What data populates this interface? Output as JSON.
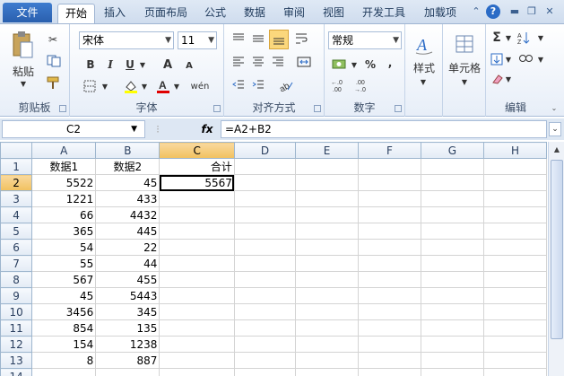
{
  "tabs": {
    "file": "文件",
    "items": [
      "开始",
      "插入",
      "页面布局",
      "公式",
      "数据",
      "审阅",
      "视图",
      "开发工具",
      "加载项"
    ],
    "active": "开始"
  },
  "ribbon": {
    "clipboard": {
      "label": "剪贴板",
      "paste": "粘贴"
    },
    "font": {
      "label": "字体",
      "name": "宋体",
      "size": "11",
      "bold": "B",
      "italic": "I",
      "underline": "U",
      "grow": "A",
      "shrink": "A",
      "phonetic": "wén"
    },
    "alignment": {
      "label": "对齐方式"
    },
    "number": {
      "label": "数字",
      "format": "常规",
      "percent": "%",
      "comma": ",",
      "inc_decimal": "+.0 .00",
      "dec_decimal": ".00 →.0"
    },
    "styles": {
      "label": "样式"
    },
    "cells": {
      "label": "单元格"
    },
    "editing": {
      "label": "编辑",
      "sum": "Σ"
    }
  },
  "formula_bar": {
    "name_box": "C2",
    "fx": "fx",
    "formula": "=A2+B2"
  },
  "grid": {
    "columns": [
      "A",
      "B",
      "C",
      "D",
      "E",
      "F",
      "G",
      "H"
    ],
    "rows": [
      [
        "数据1",
        "数据2",
        "合计",
        "",
        "",
        "",
        "",
        ""
      ],
      [
        "5522",
        "45",
        "5567",
        "",
        "",
        "",
        "",
        ""
      ],
      [
        "1221",
        "433",
        "",
        "",
        "",
        "",
        "",
        ""
      ],
      [
        "66",
        "4432",
        "",
        "",
        "",
        "",
        "",
        ""
      ],
      [
        "365",
        "445",
        "",
        "",
        "",
        "",
        "",
        ""
      ],
      [
        "54",
        "22",
        "",
        "",
        "",
        "",
        "",
        ""
      ],
      [
        "55",
        "44",
        "",
        "",
        "",
        "",
        "",
        ""
      ],
      [
        "567",
        "455",
        "",
        "",
        "",
        "",
        "",
        ""
      ],
      [
        "45",
        "5443",
        "",
        "",
        "",
        "",
        "",
        ""
      ],
      [
        "3456",
        "345",
        "",
        "",
        "",
        "",
        "",
        ""
      ],
      [
        "854",
        "135",
        "",
        "",
        "",
        "",
        "",
        ""
      ],
      [
        "154",
        "1238",
        "",
        "",
        "",
        "",
        "",
        ""
      ],
      [
        "8",
        "887",
        "",
        "",
        "",
        "",
        "",
        ""
      ],
      [
        "",
        "",
        "",
        "",
        "",
        "",
        "",
        ""
      ]
    ]
  }
}
